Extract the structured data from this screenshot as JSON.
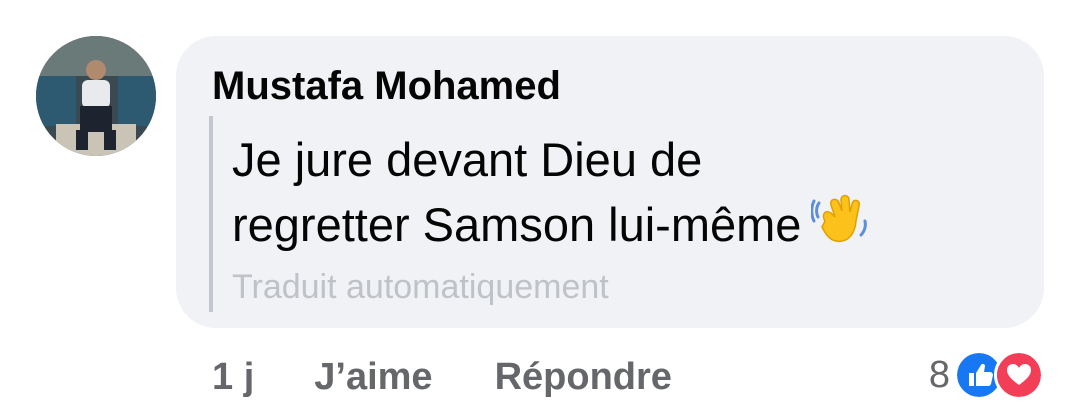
{
  "comment": {
    "author": "Mustafa Mohamed",
    "text_lines": [
      "Je jure devant Dieu de",
      "regretter Samson lui-même"
    ],
    "emoji": "waving-hand-emoji",
    "translation_note": "Traduit automatiquement"
  },
  "actions": {
    "time": "1 j",
    "like_label": "J’aime",
    "reply_label": "Répondre"
  },
  "reactions": {
    "count": "8",
    "icons": [
      "like-reaction-icon",
      "love-reaction-icon"
    ]
  },
  "colors": {
    "bubble_bg": "#f0f2f5",
    "text": "#050505",
    "secondary": "#65676b",
    "like_blue": "#1877f2",
    "love_red": "#f33e58"
  }
}
